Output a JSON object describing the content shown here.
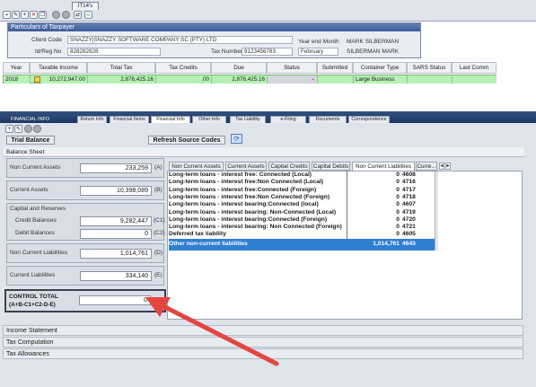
{
  "module_tab": "IT14's",
  "particulars": {
    "title": "Particulars of Taxpayer",
    "client_code_label": "Client Code",
    "client_code_value": "SNAZZY|SNAZZY SOFTWARE COMPANY SC (PTY) LTD",
    "id_reg_label": "Id/Reg No",
    "id_reg_value": "828282828",
    "tax_number_label": "Tax Number",
    "tax_number_value": "9123456783",
    "year_end_label": "Year end Month",
    "year_end_value": "February",
    "person1": "MARK SILBERMAN",
    "person2": "SILBERMAN MARK"
  },
  "year_grid": {
    "headers": [
      "Year",
      "Taxable Income",
      "Total Tax",
      "Tax Credits",
      "Due",
      "Status",
      "Submitted",
      "Container Type",
      "SARS Status",
      "Last Comm"
    ],
    "row": {
      "year": "2018",
      "taxable_income": "10,272,947.00",
      "total_tax": "2,876,425.16",
      "tax_credits": ".00",
      "due": "2,876,425.16",
      "status": "",
      "submitted": "",
      "container_type": "Large Business",
      "sars_status": "",
      "last_comm": ""
    }
  },
  "financial_window_label": "FINANCIAL INFO",
  "section_tabs": [
    "Return Info",
    "Financial Items",
    "Financial Info",
    "Other Info",
    "Tax Liability",
    "e-Filing",
    "Documents",
    "Correspondence"
  ],
  "active_section_tab": "Financial Info",
  "trial_balance_button": "Trial Balance",
  "refresh_button": "Refresh Source Codes",
  "balance_sheet_label": "Balance Sheet",
  "balance_sheet": {
    "non_current_assets": {
      "label": "Non Current Assets",
      "value": "233,259",
      "code": "(A)"
    },
    "current_assets": {
      "label": "Current Assets",
      "value": "10,398,089",
      "code": "(B)"
    },
    "capital_reserves_label": "Capital and Reserves",
    "credit_balances": {
      "label": "Credit Balances",
      "value": "9,282,447",
      "code": "(C1)"
    },
    "debit_balances": {
      "label": "Debit Balances",
      "value": "0",
      "code": "(C2)"
    },
    "non_current_liabilities": {
      "label": "Non Current Liabilities",
      "value": "1,014,761",
      "code": "(D)"
    },
    "current_liabilities": {
      "label": "Current Liabilities",
      "value": "334,140",
      "code": "(E)"
    },
    "control_total": {
      "label": "CONTROL TOTAL",
      "formula": "(A+B-C1+C2-D-E)",
      "value": "0"
    }
  },
  "detail_tabs": [
    "Non Current Assets",
    "Current Assets",
    "Capital Credits",
    "Capital Debits",
    "Non Current Liabilities",
    "Curre..."
  ],
  "active_detail_tab": "Non Current Liabilities",
  "liabilities_rows": [
    {
      "desc": "Long-term loans - interest free: Connected (Local)",
      "amount": "0",
      "code": "4608"
    },
    {
      "desc": "Long-term loans - interest free:Non Connected (Local)",
      "amount": "0",
      "code": "4716"
    },
    {
      "desc": "Long-term loans - interest free:Connected (Foreign)",
      "amount": "0",
      "code": "4717"
    },
    {
      "desc": "Long-term loans - interest free:Non Connected (Foreign)",
      "amount": "0",
      "code": "4718"
    },
    {
      "desc": "Long-term loans - interest bearing:Connected (local)",
      "amount": "0",
      "code": "4607"
    },
    {
      "desc": "Long-term loans - interest bearing: Non-Connected (Local)",
      "amount": "0",
      "code": "4719"
    },
    {
      "desc": "Long-term loans - interest bearing:Connected (Foreign)",
      "amount": "0",
      "code": "4720"
    },
    {
      "desc": "Long-term loans - interest bearing: Non Connected (Foreign)",
      "amount": "0",
      "code": "4721"
    },
    {
      "desc": "Deferred tax liability",
      "amount": "0",
      "code": "4605"
    },
    {
      "desc": "Other non-current liabilities",
      "amount": "1,014,761",
      "code": "4643"
    }
  ],
  "bottom_sections": [
    "Income Statement",
    "Tax Computation",
    "Tax Allowances"
  ],
  "colors": {
    "grid_highlight": "#b6f0b4",
    "selected_row": "#2f7fd3",
    "arrow": "#e2463f",
    "header_blue": "#3c5b96"
  }
}
